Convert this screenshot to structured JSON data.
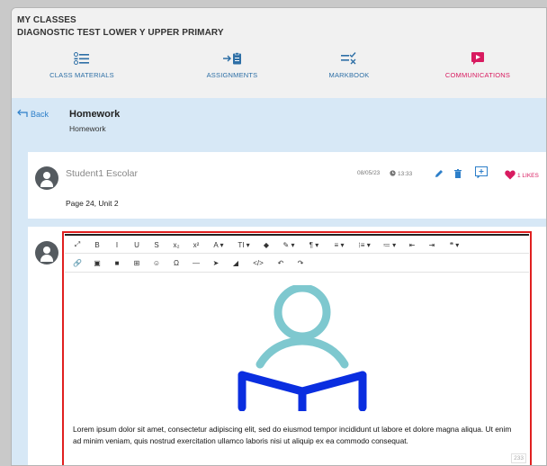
{
  "header": {
    "line1": "MY CLASSES",
    "line2": "DIAGNOSTIC TEST LOWER Y UPPER PRIMARY"
  },
  "nav": {
    "items": [
      {
        "label": "CLASS MATERIALS",
        "icon": "list-icon"
      },
      {
        "label": "ASSIGNMENTS",
        "icon": "clipboard-icon"
      },
      {
        "label": "MARKBOOK",
        "icon": "markbook-icon"
      },
      {
        "label": "COMMUNICATIONS",
        "icon": "play-message-icon"
      }
    ],
    "active": "COMMUNICATIONS"
  },
  "page": {
    "back_label": "Back",
    "title": "Homework",
    "subtitle": "Homework"
  },
  "post": {
    "author": "Student1 Escolar",
    "date": "08/05/23",
    "time": "13:33",
    "likes": "1 LIKES",
    "text": "Page 24, Unit 2"
  },
  "editor": {
    "toolbar_row1": [
      "⤢",
      "B",
      "I",
      "U",
      "S",
      "x₂",
      "x²",
      "A ▾",
      "TI ▾",
      "◆",
      "✎ ▾",
      "¶ ▾",
      "≡ ▾",
      "⁝≡ ▾",
      "≔ ▾",
      "⇤",
      "⇥",
      "❝ ▾"
    ],
    "toolbar_row2": [
      "🔗",
      "▣",
      "■",
      "⊞",
      "☺",
      "Ω",
      "—",
      "➤",
      "◢",
      "</>",
      "↶",
      "↷"
    ],
    "body_text": "Lorem ipsum dolor sit amet, consectetur adipiscing elit, sed do eiusmod tempor incididunt ut labore et dolore magna aliqua. Ut enim ad minim veniam, quis nostrud exercitation ullamco laboris nisi ut aliquip ex ea commodo consequat.",
    "char_count": "233"
  },
  "colors": {
    "accent": "#2d6fa6",
    "active": "#d81b60",
    "highlight_border": "#e02020",
    "illustration_head": "#7ec8cf",
    "illustration_book": "#0a2ee0"
  }
}
